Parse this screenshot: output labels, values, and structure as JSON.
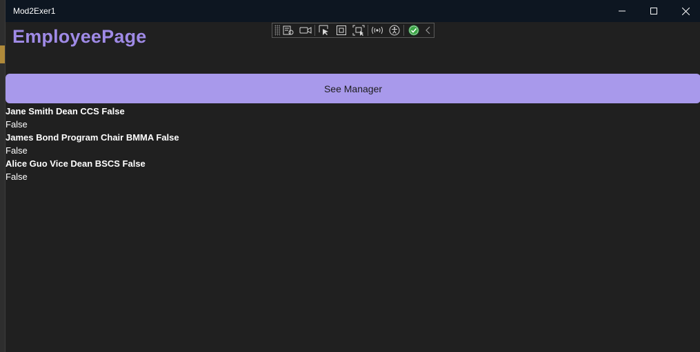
{
  "window": {
    "title": "Mod2Exer1",
    "minimize_icon": "minimize-icon",
    "maximize_icon": "maximize-icon",
    "close_icon": "close-icon"
  },
  "page": {
    "title": "EmployeePage",
    "title_color": "#9f8ae6"
  },
  "debug_toolbar": {
    "tools": [
      "live-visual-tree-icon",
      "record-icon",
      "select-element-icon",
      "display-layout-adorners-icon",
      "track-focus-icon",
      "hot-reload-icon",
      "accessibility-icon",
      "binding-ok-icon",
      "collapse-chevron-icon"
    ]
  },
  "see_manager_button": {
    "label": "See Manager",
    "color": "#a899eb"
  },
  "employees": [
    {
      "summary": "Jane Smith Dean CCS False",
      "detail": "False"
    },
    {
      "summary": "James Bond Program Chair BMMA False",
      "detail": "False"
    },
    {
      "summary": "Alice Guo Vice Dean BSCS False",
      "detail": "False"
    }
  ]
}
